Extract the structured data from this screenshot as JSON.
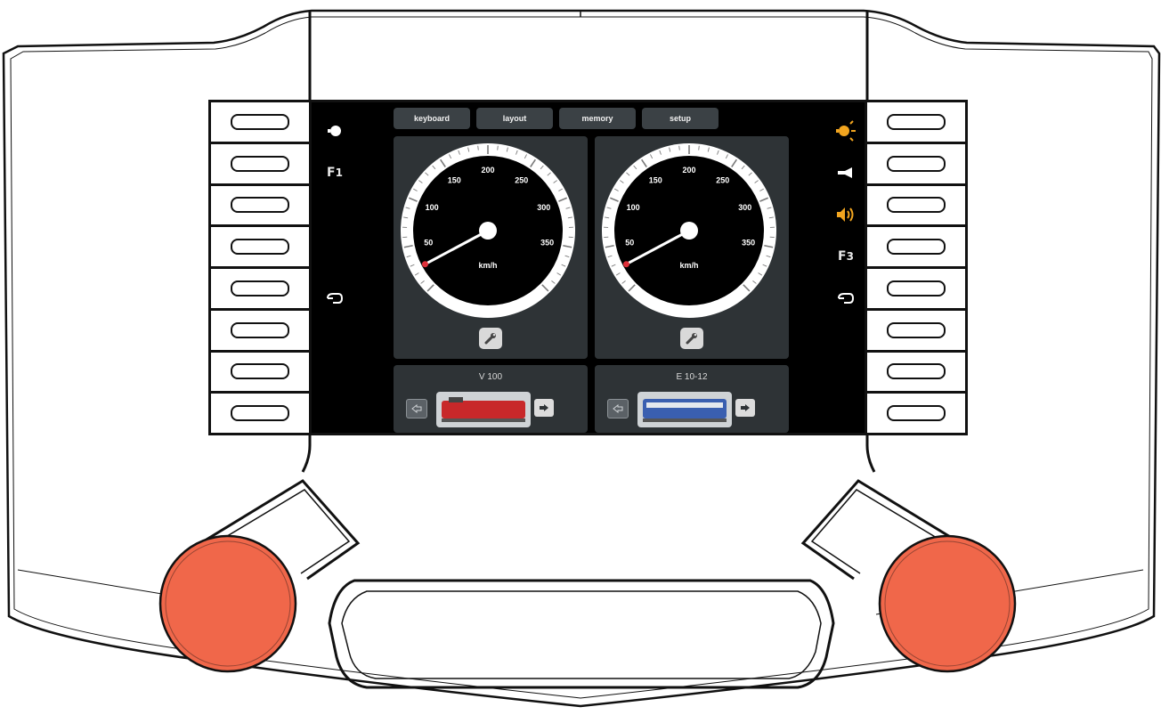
{
  "tabs": [
    {
      "label": "keyboard"
    },
    {
      "label": "layout"
    },
    {
      "label": "memory"
    },
    {
      "label": "setup"
    }
  ],
  "function_icons": {
    "left": [
      {
        "icon": "headlight-icon"
      },
      {
        "icon": "function-f1-icon",
        "text": "F",
        "sub": "1"
      },
      {
        "icon": "blank"
      },
      {
        "icon": "blank"
      },
      {
        "icon": "coupling-hook-icon"
      },
      {
        "icon": "blank"
      },
      {
        "icon": "blank"
      },
      {
        "icon": "blank"
      }
    ],
    "right": [
      {
        "icon": "headlight-on-icon"
      },
      {
        "icon": "horn-icon"
      },
      {
        "icon": "speaker-icon"
      },
      {
        "icon": "function-f3-icon",
        "text": "F",
        "sub": "3"
      },
      {
        "icon": "coupling-hook-icon"
      },
      {
        "icon": "blank"
      },
      {
        "icon": "blank"
      },
      {
        "icon": "blank"
      }
    ]
  },
  "speedometers": [
    {
      "unit": "km/h",
      "min": 0,
      "max": 400,
      "current": 25,
      "labels": [
        "50",
        "100",
        "150",
        "200",
        "250",
        "300",
        "350"
      ]
    },
    {
      "unit": "km/h",
      "min": 0,
      "max": 400,
      "current": 25,
      "labels": [
        "50",
        "100",
        "150",
        "200",
        "250",
        "300",
        "350"
      ]
    }
  ],
  "locos": [
    {
      "name": "V 100",
      "color": "#c8282a"
    },
    {
      "name": "E 10-12",
      "color": "#3a5fb0"
    }
  ],
  "colors": {
    "knob": "#f0674a",
    "screen": "#000000",
    "panel": "#2e3336",
    "tab": "#3b4145",
    "indicator_on": "#f2a51f"
  }
}
